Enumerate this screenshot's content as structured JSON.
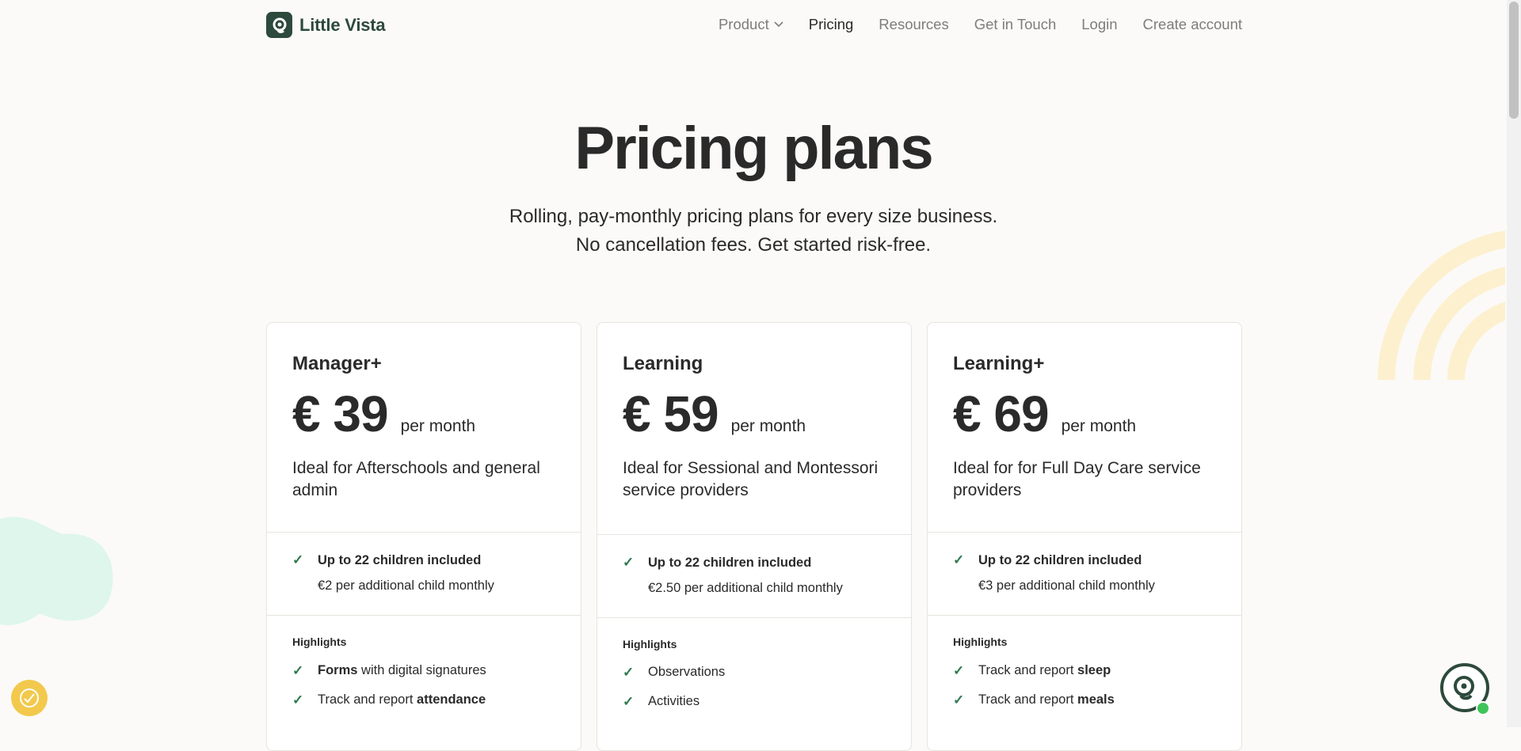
{
  "brand": {
    "name": "Little Vista",
    "color": "#2d4a3c"
  },
  "nav": {
    "items": [
      {
        "label": "Product",
        "has_dropdown": true,
        "active": false
      },
      {
        "label": "Pricing",
        "active": true
      },
      {
        "label": "Resources",
        "active": false
      },
      {
        "label": "Get in Touch",
        "active": false
      },
      {
        "label": "Login",
        "active": false
      },
      {
        "label": "Create account",
        "active": false
      }
    ]
  },
  "hero": {
    "title": "Pricing plans",
    "subtitle_line1": "Rolling, pay-monthly pricing plans for every size business.",
    "subtitle_line2": "No cancellation fees. Get started risk-free."
  },
  "plans": [
    {
      "name": "Manager+",
      "price": "€ 39",
      "period": "per month",
      "description": "Ideal for Afterschools and general admin",
      "included": "Up to 22 children included",
      "additional": "€2 per additional child monthly",
      "highlights_title": "Highlights",
      "highlights": [
        {
          "bold_prefix": "Forms",
          "text": " with digital signatures",
          "bold_suffix": ""
        },
        {
          "bold_prefix": "",
          "text": "Track and report ",
          "bold_suffix": "attendance"
        }
      ]
    },
    {
      "name": "Learning",
      "price": "€ 59",
      "period": "per month",
      "description": "Ideal for Sessional and Montessori service providers",
      "included": "Up to 22 children included",
      "additional": "€2.50 per additional child monthly",
      "highlights_title": "Highlights",
      "highlights": [
        {
          "bold_prefix": "",
          "text": "Observations",
          "bold_suffix": ""
        },
        {
          "bold_prefix": "",
          "text": "Activities",
          "bold_suffix": ""
        }
      ]
    },
    {
      "name": "Learning+",
      "price": "€ 69",
      "period": "per month",
      "description": "Ideal for for Full Day Care service providers",
      "included": "Up to 22 children included",
      "additional": "€3 per additional child monthly",
      "highlights_title": "Highlights",
      "highlights": [
        {
          "bold_prefix": "",
          "text": "Track and report ",
          "bold_suffix": "sleep"
        },
        {
          "bold_prefix": "",
          "text": "Track and report ",
          "bold_suffix": "meals"
        }
      ]
    }
  ],
  "colors": {
    "check": "#2f7a4f",
    "accent_yellow": "#f2c94c",
    "status_online": "#3fc45a"
  },
  "icons": [
    "logo-icon",
    "chevron-down-icon",
    "check-icon",
    "accessibility-icon",
    "chat-icon"
  ]
}
